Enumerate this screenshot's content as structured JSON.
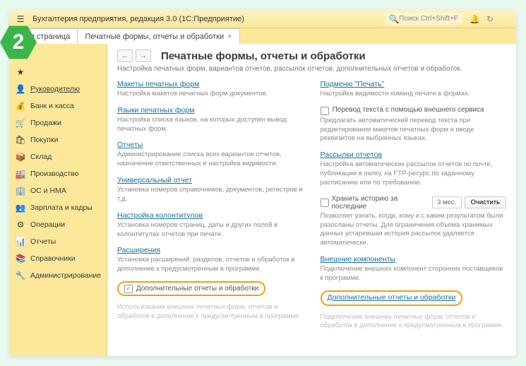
{
  "titlebar": {
    "app_title": "Бухгалтерия предприятия, редакция 3.0  (1С:Предприятие)",
    "search_placeholder": "Поиск Ctrl+Shift+F"
  },
  "tabs": [
    {
      "label": "ьная страница"
    },
    {
      "label": "Печатные формы, отчеты и обработки"
    }
  ],
  "sidebar": [
    {
      "icon": "≡",
      "label": ""
    },
    {
      "icon": "★",
      "label": ""
    },
    {
      "icon": "👤",
      "label": "Руководителю",
      "underlined": true
    },
    {
      "icon": "💰",
      "label": "Банк и касса"
    },
    {
      "icon": "🛒",
      "label": "Продажи"
    },
    {
      "icon": "🛍",
      "label": "Покупки"
    },
    {
      "icon": "📦",
      "label": "Склад"
    },
    {
      "icon": "🏭",
      "label": "Производство"
    },
    {
      "icon": "🏢",
      "label": "ОС и НМА"
    },
    {
      "icon": "👥",
      "label": "Зарплата и кадры"
    },
    {
      "icon": "⚙",
      "label": "Операции"
    },
    {
      "icon": "📊",
      "label": "Отчеты"
    },
    {
      "icon": "📚",
      "label": "Справочники"
    },
    {
      "icon": "🔧",
      "label": "Администрирование"
    }
  ],
  "main": {
    "heading": "Печатные формы, отчеты и обработки",
    "subtitle": "Настройка печатных форм, вариантов отчетов, рассылок отчетов, дополнительных отчетов и обработок.",
    "left": [
      {
        "link": "Макеты печатных форм",
        "desc": "Настройка макетов печатных форм документов."
      },
      {
        "link": "Языки печатных форм",
        "desc": "Настройка списка языков, на которых доступен вывод печатных форм."
      },
      {
        "link": "Отчеты",
        "desc": "Администрирование списка всех вариантов отчетов, назначение ответственных и настройка видимости."
      },
      {
        "link": "Универсальный отчет",
        "desc": "Установка номеров справочников, документов, регистров и т.д."
      },
      {
        "link": "Настройка колонтитулов",
        "desc": "Установка номеров страниц, даты и других полей в колонтитулах отчетов при печати."
      },
      {
        "link": "Расширения",
        "desc": "Установка расширений: разделов, отчетов и обработок в дополнение к предусмотренным в программе."
      }
    ],
    "left_highlight": {
      "checked": true,
      "label": "Дополнительные отчеты и обработки"
    },
    "left_footer_desc": "Использование внешних печатных форм, отчетов и обработок в дополнение к предусмотренным в программе.",
    "right_header": {
      "link": "Подменю \"Печать\"",
      "desc": "Настройка видимости команд печати в формах."
    },
    "right_translate": {
      "label": "Перевод текста с помощью внешнего сервиса",
      "desc": "Предлагать автоматический перевод текста при редактировании макетов печатных форм и вводе реквизитов на выбранных языках."
    },
    "right_mail": {
      "link": "Рассылки отчетов",
      "desc": "Настройка автоматических рассылок отчетов по почте, публикации в папку, на FTP-ресурс по заданному расписанию или по требованию."
    },
    "right_history": {
      "label": "Хранить историю за последние",
      "value": "3 мес.",
      "button": "Очистить",
      "desc": "Позволяет узнать, когда, кому и с каким результатом были разосланы отчеты. Для ограничения объема хранимых данных устаревшая история рассылок удаляется автоматически."
    },
    "right_external": {
      "link": "Внешние компоненты",
      "desc": "Подключение внешних компонент сторонних поставщиков к программе."
    },
    "right_highlight": {
      "link": "Дополнительные отчеты и обработки"
    },
    "right_footer_desc": "Подключение внешних печатных форм, отчетов и обработок в дополнение к предусмотренным в программе."
  },
  "badge": "2"
}
